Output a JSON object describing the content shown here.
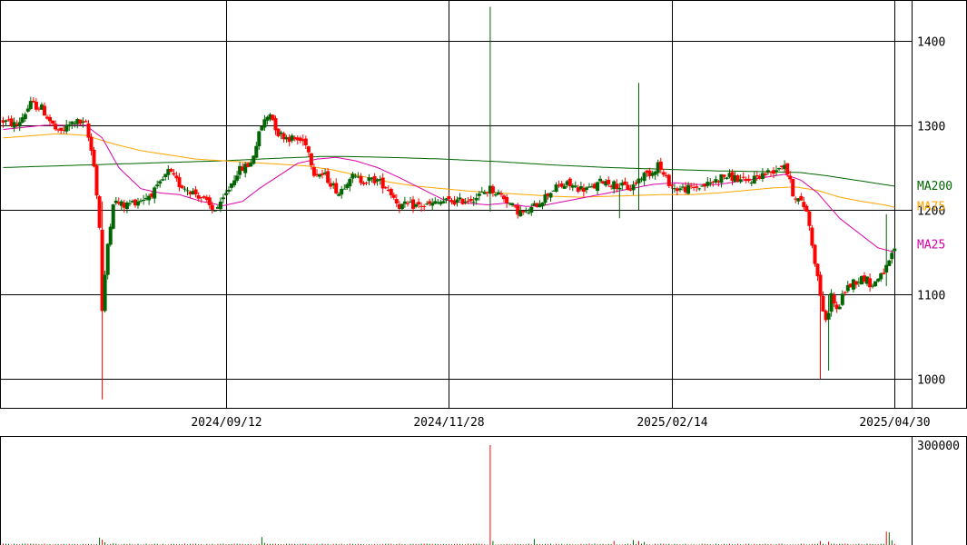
{
  "chart_data": [
    {
      "type": "candlestick",
      "ylim": [
        966,
        1448
      ],
      "y_ticks": [
        1000,
        1100,
        1200,
        1300,
        1400
      ],
      "x_tick_labels": [
        "2024/09/12",
        "2024/11/28",
        "2025/02/14",
        "2025/04/30"
      ],
      "x_tick_index": [
        81,
        162,
        243,
        324
      ],
      "colors": {
        "up": "#006400",
        "down": "#ff0000",
        "ma25": "#dd00aa",
        "ma75": "#ffa500",
        "ma200": "#006400"
      },
      "legend": [
        {
          "label": "MA200",
          "color": "#006400"
        },
        {
          "label": "MA75",
          "color": "#ffa500"
        },
        {
          "label": "MA25",
          "color": "#dd00aa"
        }
      ],
      "price_anchors": [
        [
          0,
          1305
        ],
        [
          5,
          1300
        ],
        [
          10,
          1325
        ],
        [
          14,
          1320
        ],
        [
          20,
          1290
        ],
        [
          26,
          1305
        ],
        [
          30,
          1300
        ],
        [
          33,
          1255
        ],
        [
          35,
          1180
        ],
        [
          36,
          1080
        ],
        [
          38,
          1160
        ],
        [
          40,
          1210
        ],
        [
          44,
          1205
        ],
        [
          48,
          1210
        ],
        [
          52,
          1215
        ],
        [
          56,
          1225
        ],
        [
          60,
          1245
        ],
        [
          64,
          1230
        ],
        [
          67,
          1225
        ],
        [
          72,
          1215
        ],
        [
          76,
          1200
        ],
        [
          79,
          1205
        ],
        [
          82,
          1225
        ],
        [
          85,
          1245
        ],
        [
          90,
          1255
        ],
        [
          94,
          1300
        ],
        [
          97,
          1315
        ],
        [
          100,
          1290
        ],
        [
          104,
          1285
        ],
        [
          110,
          1280
        ],
        [
          113,
          1245
        ],
        [
          117,
          1240
        ],
        [
          122,
          1220
        ],
        [
          126,
          1240
        ],
        [
          130,
          1235
        ],
        [
          136,
          1235
        ],
        [
          140,
          1225
        ],
        [
          144,
          1205
        ],
        [
          148,
          1205
        ],
        [
          154,
          1205
        ],
        [
          160,
          1210
        ],
        [
          166,
          1210
        ],
        [
          172,
          1215
        ],
        [
          177,
          1225
        ],
        [
          182,
          1215
        ],
        [
          186,
          1200
        ],
        [
          190,
          1195
        ],
        [
          195,
          1210
        ],
        [
          200,
          1225
        ],
        [
          205,
          1230
        ],
        [
          210,
          1225
        ],
        [
          214,
          1225
        ],
        [
          218,
          1235
        ],
        [
          222,
          1230
        ],
        [
          228,
          1225
        ],
        [
          232,
          1240
        ],
        [
          236,
          1245
        ],
        [
          238,
          1255
        ],
        [
          240,
          1240
        ],
        [
          244,
          1225
        ],
        [
          250,
          1225
        ],
        [
          256,
          1230
        ],
        [
          262,
          1240
        ],
        [
          266,
          1238
        ],
        [
          270,
          1232
        ],
        [
          274,
          1240
        ],
        [
          279,
          1245
        ],
        [
          284,
          1255
        ],
        [
          287,
          1220
        ],
        [
          292,
          1200
        ],
        [
          295,
          1140
        ],
        [
          297,
          1100
        ],
        [
          299,
          1065
        ],
        [
          301,
          1100
        ],
        [
          303,
          1080
        ],
        [
          306,
          1105
        ],
        [
          309,
          1115
        ],
        [
          313,
          1120
        ],
        [
          316,
          1110
        ],
        [
          319,
          1125
        ],
        [
          321,
          1130
        ],
        [
          323,
          1145
        ],
        [
          324,
          1155
        ]
      ],
      "ma25_anchors": [
        [
          0,
          1295
        ],
        [
          15,
          1300
        ],
        [
          30,
          1300
        ],
        [
          36,
          1285
        ],
        [
          42,
          1250
        ],
        [
          50,
          1225
        ],
        [
          57,
          1220
        ],
        [
          64,
          1218
        ],
        [
          72,
          1210
        ],
        [
          80,
          1205
        ],
        [
          87,
          1210
        ],
        [
          93,
          1225
        ],
        [
          100,
          1240
        ],
        [
          107,
          1255
        ],
        [
          114,
          1260
        ],
        [
          121,
          1262
        ],
        [
          128,
          1258
        ],
        [
          136,
          1250
        ],
        [
          144,
          1238
        ],
        [
          152,
          1225
        ],
        [
          160,
          1212
        ],
        [
          168,
          1208
        ],
        [
          176,
          1206
        ],
        [
          183,
          1208
        ],
        [
          190,
          1204
        ],
        [
          196,
          1205
        ],
        [
          204,
          1210
        ],
        [
          212,
          1215
        ],
        [
          220,
          1220
        ],
        [
          228,
          1225
        ],
        [
          236,
          1230
        ],
        [
          244,
          1232
        ],
        [
          252,
          1230
        ],
        [
          260,
          1230
        ],
        [
          268,
          1234
        ],
        [
          276,
          1238
        ],
        [
          284,
          1242
        ],
        [
          290,
          1235
        ],
        [
          296,
          1220
        ],
        [
          304,
          1190
        ],
        [
          312,
          1170
        ],
        [
          318,
          1155
        ],
        [
          324,
          1150
        ]
      ],
      "ma75_anchors": [
        [
          0,
          1285
        ],
        [
          20,
          1290
        ],
        [
          30,
          1288
        ],
        [
          40,
          1278
        ],
        [
          50,
          1270
        ],
        [
          60,
          1265
        ],
        [
          70,
          1260
        ],
        [
          80,
          1258
        ],
        [
          90,
          1256
        ],
        [
          100,
          1254
        ],
        [
          110,
          1252
        ],
        [
          120,
          1247
        ],
        [
          130,
          1240
        ],
        [
          140,
          1233
        ],
        [
          150,
          1228
        ],
        [
          160,
          1225
        ],
        [
          170,
          1222
        ],
        [
          180,
          1220
        ],
        [
          190,
          1218
        ],
        [
          200,
          1216
        ],
        [
          210,
          1215
        ],
        [
          220,
          1216
        ],
        [
          230,
          1217
        ],
        [
          240,
          1218
        ],
        [
          250,
          1218
        ],
        [
          260,
          1220
        ],
        [
          270,
          1223
        ],
        [
          280,
          1226
        ],
        [
          288,
          1227
        ],
        [
          296,
          1223
        ],
        [
          304,
          1215
        ],
        [
          312,
          1210
        ],
        [
          320,
          1206
        ],
        [
          324,
          1203
        ]
      ],
      "ma200_anchors": [
        [
          0,
          1250
        ],
        [
          20,
          1252
        ],
        [
          40,
          1254
        ],
        [
          60,
          1256
        ],
        [
          80,
          1258
        ],
        [
          100,
          1261
        ],
        [
          115,
          1263
        ],
        [
          125,
          1263
        ],
        [
          140,
          1262
        ],
        [
          160,
          1260
        ],
        [
          180,
          1257
        ],
        [
          200,
          1253
        ],
        [
          220,
          1250
        ],
        [
          240,
          1248
        ],
        [
          260,
          1246
        ],
        [
          280,
          1245
        ],
        [
          290,
          1244
        ],
        [
          300,
          1240
        ],
        [
          310,
          1235
        ],
        [
          320,
          1230
        ],
        [
          324,
          1228
        ]
      ],
      "spikes": [
        [
          36,
          1210,
          976
        ],
        [
          177,
          1440,
          1198
        ],
        [
          224,
          1205,
          1190
        ],
        [
          231,
          1350,
          1200
        ],
        [
          297,
          1110,
          1000
        ],
        [
          300,
          1100,
          1010
        ],
        [
          321,
          1195,
          1110
        ]
      ]
    },
    {
      "type": "bar",
      "ylim": [
        0,
        300000
      ],
      "y_ticks": [
        300000
      ],
      "baseline_volume": 3000,
      "volume_spikes": [
        [
          35,
          22000
        ],
        [
          36,
          16000
        ],
        [
          37,
          8000
        ],
        [
          40,
          5000
        ],
        [
          94,
          24000
        ],
        [
          95,
          6000
        ],
        [
          177,
          300000
        ],
        [
          178,
          12000
        ],
        [
          193,
          18000
        ],
        [
          222,
          12000
        ],
        [
          229,
          15000
        ],
        [
          231,
          12000
        ],
        [
          233,
          9000
        ],
        [
          297,
          12000
        ],
        [
          300,
          10000
        ],
        [
          321,
          40000
        ],
        [
          322,
          38000
        ],
        [
          323,
          14000
        ]
      ]
    }
  ]
}
